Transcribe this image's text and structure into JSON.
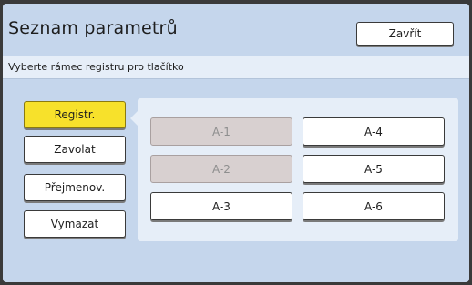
{
  "window": {
    "title": "Seznam parametrů",
    "close_label": "Zavřít"
  },
  "instruction": "Vyberte rámec registru pro tlačítko",
  "actions": [
    {
      "label": "Registr.",
      "active": true
    },
    {
      "label": "Zavolat",
      "active": false
    },
    {
      "label": "Přejmenov.",
      "active": false
    },
    {
      "label": "Vymazat",
      "active": false
    }
  ],
  "registers": [
    {
      "label": "A-1",
      "enabled": false
    },
    {
      "label": "A-2",
      "enabled": false
    },
    {
      "label": "A-3",
      "enabled": true
    },
    {
      "label": "A-4",
      "enabled": true
    },
    {
      "label": "A-5",
      "enabled": true
    },
    {
      "label": "A-6",
      "enabled": true
    }
  ],
  "colors": {
    "background": "#c5d6ec",
    "panel": "#e6eef8",
    "active_button": "#f7e12b",
    "disabled_button": "#d8d0d0"
  }
}
